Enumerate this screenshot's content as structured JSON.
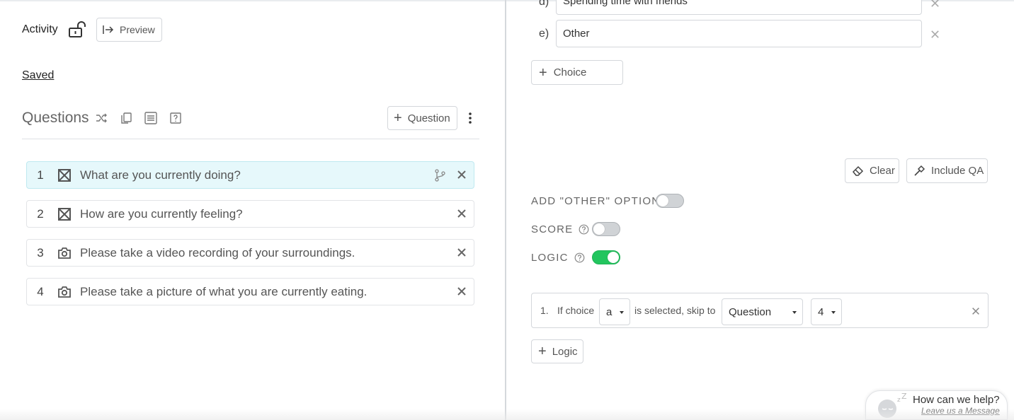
{
  "header": {
    "activity_label": "Activity",
    "preview_label": "Preview",
    "saved_label": "Saved"
  },
  "questions": {
    "title": "Questions",
    "add_label": "Question",
    "items": [
      {
        "number": "1",
        "text": "What are you currently doing?",
        "type_icon": "multiple-choice-icon",
        "has_logic": true
      },
      {
        "number": "2",
        "text": "How are you currently feeling?",
        "type_icon": "multiple-choice-icon",
        "has_logic": false
      },
      {
        "number": "3",
        "text": "Please take a video recording of your surroundings.",
        "type_icon": "camera-icon",
        "has_logic": false
      },
      {
        "number": "4",
        "text": "Please take a picture of what you are currently eating.",
        "type_icon": "camera-icon",
        "has_logic": false
      }
    ]
  },
  "choices": {
    "items": [
      {
        "letter": "d)",
        "value": "Spending time with friends"
      },
      {
        "letter": "e)",
        "value": "Other"
      }
    ],
    "add_label": "Choice"
  },
  "actions": {
    "clear_label": "Clear",
    "include_qa_label": "Include QA"
  },
  "options": {
    "other_label": "ADD \"OTHER\" OPTION",
    "other_on": false,
    "score_label": "SCORE",
    "score_on": false,
    "logic_label": "LOGIC",
    "logic_on": true
  },
  "logic": {
    "rule_number": "1.",
    "if_choice": "If choice",
    "choice_value": "a",
    "is_selected": "is selected, skip to",
    "target_type": "Question",
    "target_number": "4",
    "add_label": "Logic"
  },
  "help_widget": {
    "title": "How can we help?",
    "subtitle": "Leave us a Message"
  },
  "colors": {
    "active_row_bg": "#e6f8fb",
    "toggle_on": "#22c55e",
    "toggle_off": "#d0d3d6"
  }
}
